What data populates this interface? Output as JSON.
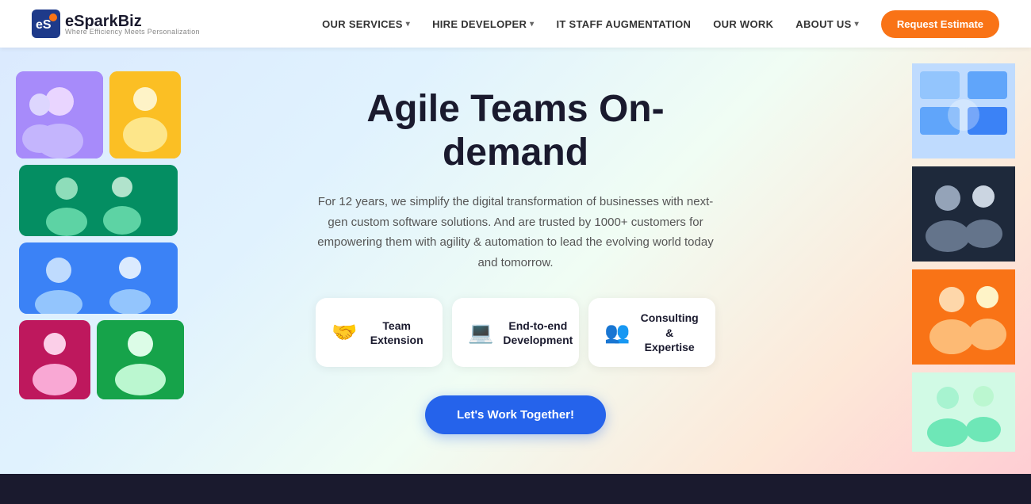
{
  "nav": {
    "logo_name": "eSparkBiz",
    "logo_subtitle": "Where Efficiency Meets Personalization",
    "links": [
      {
        "label": "OUR SERVICES",
        "has_dropdown": true,
        "id": "our-services"
      },
      {
        "label": "HIRE DEVELOPER",
        "has_dropdown": true,
        "id": "hire-developer"
      },
      {
        "label": "IT STAFF AUGMENTATION",
        "has_dropdown": false,
        "id": "it-staff"
      },
      {
        "label": "OUR WORK",
        "has_dropdown": false,
        "id": "our-work"
      },
      {
        "label": "ABOUT US",
        "has_dropdown": true,
        "id": "about-us"
      }
    ],
    "cta_button": "Request Estimate"
  },
  "hero": {
    "title": "Agile Teams On-demand",
    "description": "For 12 years, we simplify the digital transformation of businesses with next-gen custom software solutions. And are trusted by 1000+ customers for empowering them with agility & automation to lead the evolving world today and tomorrow.",
    "services": [
      {
        "icon": "🤝",
        "label": "Team Extension",
        "id": "team-extension"
      },
      {
        "icon": "💻",
        "label": "End-to-end Development",
        "id": "end-to-end"
      },
      {
        "icon": "👥",
        "label": "Consulting & Expertise",
        "id": "consulting"
      }
    ],
    "cta_label": "Let's Work Together!"
  },
  "footer": {
    "bg_color": "#1a1a2e"
  }
}
